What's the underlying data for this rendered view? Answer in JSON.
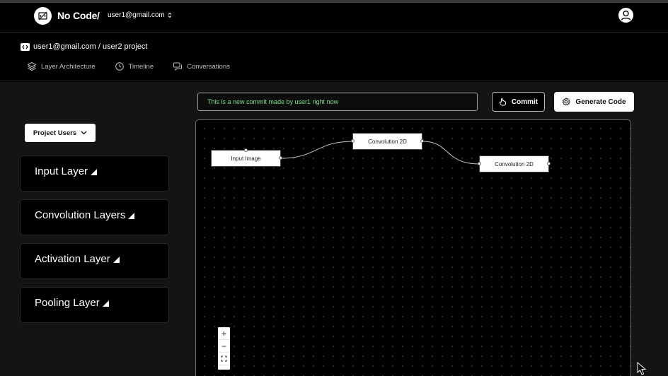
{
  "header": {
    "app_title": "No Code",
    "separator": "/",
    "account": "user1@gmail.com",
    "logo_icon": "no-code-logo-icon",
    "user_icon": "user-avatar-icon"
  },
  "breadcrumb": {
    "text": "user1@gmail.com / user2 project",
    "icon": "code-icon"
  },
  "tabs": [
    {
      "label": "Layer Architecture",
      "icon": "layers-icon"
    },
    {
      "label": "Timeline",
      "icon": "clock-icon"
    },
    {
      "label": "Conversations",
      "icon": "chat-icon"
    }
  ],
  "sidebar": {
    "project_users_label": "Project Users",
    "layers": [
      {
        "label": "Input Layer"
      },
      {
        "label": "Convolution Layers"
      },
      {
        "label": "Activation Layer"
      },
      {
        "label": "Pooling Layer"
      }
    ]
  },
  "toolbar": {
    "commit_message": "This is a new commit made by user1 right now",
    "commit_label": "Commit",
    "generate_label": "Generate Code"
  },
  "flow": {
    "nodes": [
      {
        "label": "Input Image"
      },
      {
        "label": "Convolution 2D"
      },
      {
        "label": "Convolution 2D"
      }
    ],
    "controls": {
      "zoom_in": "+",
      "zoom_out": "−"
    }
  },
  "colors": {
    "background": "#000000",
    "panel": "#141414",
    "input_text": "#7ce08a"
  }
}
